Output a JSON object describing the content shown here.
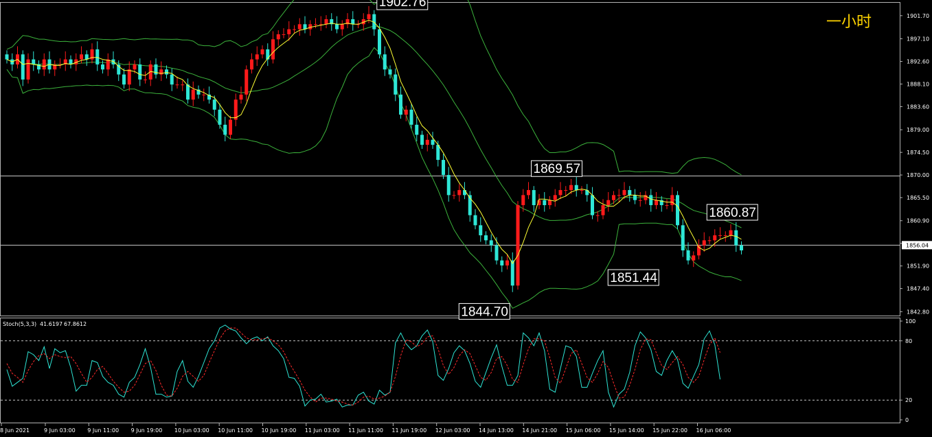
{
  "timeframe_label": "一小时",
  "chart_data": {
    "type": "candlestick",
    "price_axis": {
      "ticks": [
        "1901.70",
        "1897.10",
        "1892.60",
        "1888.10",
        "1883.60",
        "1879.00",
        "1874.50",
        "1870.00",
        "1865.50",
        "1860.90",
        "1856.40",
        "1851.90",
        "1847.40",
        "1842.80"
      ],
      "tick_values": [
        1901.7,
        1897.1,
        1892.6,
        1888.1,
        1883.6,
        1879.0,
        1874.5,
        1870.0,
        1865.5,
        1860.9,
        1856.4,
        1851.9,
        1847.4,
        1842.8
      ],
      "range": [
        1842.3,
        1904.0
      ],
      "current_price": "1856.04",
      "current_value": 1856.04
    },
    "time_axis": {
      "labels": [
        "8 Jun 2021",
        "9 Jun 03:00",
        "9 Jun 11:00",
        "9 Jun 19:00",
        "10 Jun 03:00",
        "10 Jun 11:00",
        "10 Jun 19:00",
        "11 Jun 03:00",
        "11 Jun 11:00",
        "11 Jun 19:00",
        "12 Jun 03:00",
        "14 Jun 13:00",
        "14 Jun 21:00",
        "15 Jun 06:00",
        "15 Jun 14:00",
        "15 Jun 22:00",
        "16 Jun 06:00"
      ]
    },
    "horizontal_lines": [
      1869.8,
      1856.04
    ],
    "annotations": [
      {
        "text": "1902.76",
        "value": 1902.76,
        "bar": 69
      },
      {
        "text": "1869.57",
        "value": 1869.57,
        "bar": 98
      },
      {
        "text": "1860.87",
        "value": 1860.87,
        "bar": 131
      },
      {
        "text": "1851.44",
        "value": 1851.44,
        "bar": 123
      },
      {
        "text": "1844.70",
        "value": 1844.7,
        "bar": 95
      }
    ],
    "closes": [
      1893,
      1892,
      1894,
      1889,
      1893,
      1892,
      1891,
      1893,
      1891,
      1892,
      1892,
      1893,
      1892,
      1893,
      1894,
      1893,
      1895,
      1892,
      1891,
      1893,
      1892,
      1890,
      1888,
      1891,
      1892,
      1889,
      1889,
      1892,
      1890,
      1891,
      1890,
      1888,
      1888,
      1888,
      1885,
      1887,
      1886,
      1886,
      1885,
      1883,
      1880,
      1878,
      1881,
      1885,
      1886,
      1891,
      1893,
      1894,
      1895,
      1893,
      1897,
      1898,
      1898,
      1899,
      1899,
      1900,
      1899,
      1900,
      1900,
      1900,
      1901,
      1900,
      1899,
      1900,
      1901,
      1900,
      1900,
      1901,
      1902,
      1899,
      1894,
      1891,
      1890,
      1886,
      1882,
      1883,
      1880,
      1878,
      1876,
      1877,
      1876,
      1873,
      1870,
      1866,
      1866,
      1867,
      1866,
      1862,
      1860,
      1858,
      1857,
      1856,
      1853,
      1852,
      1853,
      1848,
      1864,
      1866,
      1867,
      1864,
      1865,
      1864,
      1865,
      1866,
      1867,
      1867,
      1868,
      1867,
      1867,
      1866,
      1862,
      1862,
      1864,
      1865,
      1866,
      1866,
      1867,
      1866,
      1865,
      1865,
      1866,
      1864,
      1865,
      1864,
      1864,
      1866,
      1860,
      1855,
      1853,
      1854,
      1856,
      1857,
      1857,
      1858,
      1858,
      1858,
      1859,
      1856,
      1855
    ],
    "bars_shown": 135,
    "bollinger_bands": true,
    "moving_average": true,
    "oscillator": {
      "name": "Stoch(5,3,3)",
      "main": "41.6197",
      "signal": "67.8612",
      "levels": [
        80,
        20
      ],
      "ticks": [
        "100",
        "80",
        "20",
        "0"
      ],
      "tick_values": [
        100,
        80,
        20,
        0
      ],
      "range": [
        0,
        100
      ],
      "main_values": [
        51,
        34,
        38,
        42,
        69,
        66,
        60,
        74,
        52,
        72,
        68,
        70,
        53,
        29,
        35,
        35,
        60,
        58,
        44,
        38,
        35,
        26,
        23,
        38,
        43,
        56,
        72,
        53,
        26,
        26,
        23,
        24,
        49,
        60,
        39,
        33,
        44,
        58,
        72,
        80,
        93,
        96,
        92,
        90,
        83,
        77,
        82,
        84,
        80,
        84,
        75,
        70,
        62,
        43,
        42,
        34,
        14,
        20,
        21,
        26,
        18,
        19,
        21,
        13,
        15,
        15,
        25,
        28,
        19,
        16,
        30,
        25,
        28,
        78,
        88,
        77,
        71,
        75,
        85,
        91,
        79,
        45,
        40,
        52,
        68,
        75,
        70,
        57,
        39,
        33,
        48,
        63,
        76,
        54,
        35,
        35,
        45,
        88,
        83,
        75,
        88,
        70,
        31,
        28,
        52,
        75,
        73,
        64,
        33,
        33,
        47,
        60,
        70,
        28,
        13,
        26,
        31,
        48,
        75,
        89,
        83,
        71,
        49,
        45,
        60,
        70,
        61,
        37,
        32,
        44,
        56,
        82,
        90,
        76,
        41
      ],
      "signal_values": [
        57,
        47,
        43,
        38,
        50,
        59,
        65,
        67,
        62,
        66,
        64,
        63,
        64,
        57,
        47,
        38,
        43,
        51,
        54,
        47,
        39,
        33,
        28,
        29,
        35,
        46,
        57,
        60,
        50,
        35,
        25,
        24,
        32,
        44,
        49,
        44,
        39,
        45,
        58,
        70,
        82,
        90,
        93,
        93,
        88,
        83,
        81,
        81,
        82,
        83,
        80,
        76,
        69,
        58,
        49,
        40,
        30,
        23,
        18,
        22,
        22,
        21,
        19,
        18,
        16,
        15,
        18,
        23,
        24,
        21,
        22,
        24,
        28,
        44,
        65,
        81,
        79,
        74,
        77,
        84,
        85,
        72,
        55,
        46,
        53,
        65,
        71,
        67,
        55,
        43,
        40,
        48,
        62,
        64,
        55,
        41,
        38,
        56,
        72,
        82,
        82,
        80,
        63,
        43,
        37,
        52,
        67,
        71,
        57,
        43,
        38,
        47,
        59,
        53,
        37,
        22,
        23,
        35,
        51,
        71,
        82,
        81,
        68,
        55,
        51,
        58,
        64,
        56,
        43,
        38,
        44,
        61,
        76,
        83,
        68
      ]
    }
  }
}
